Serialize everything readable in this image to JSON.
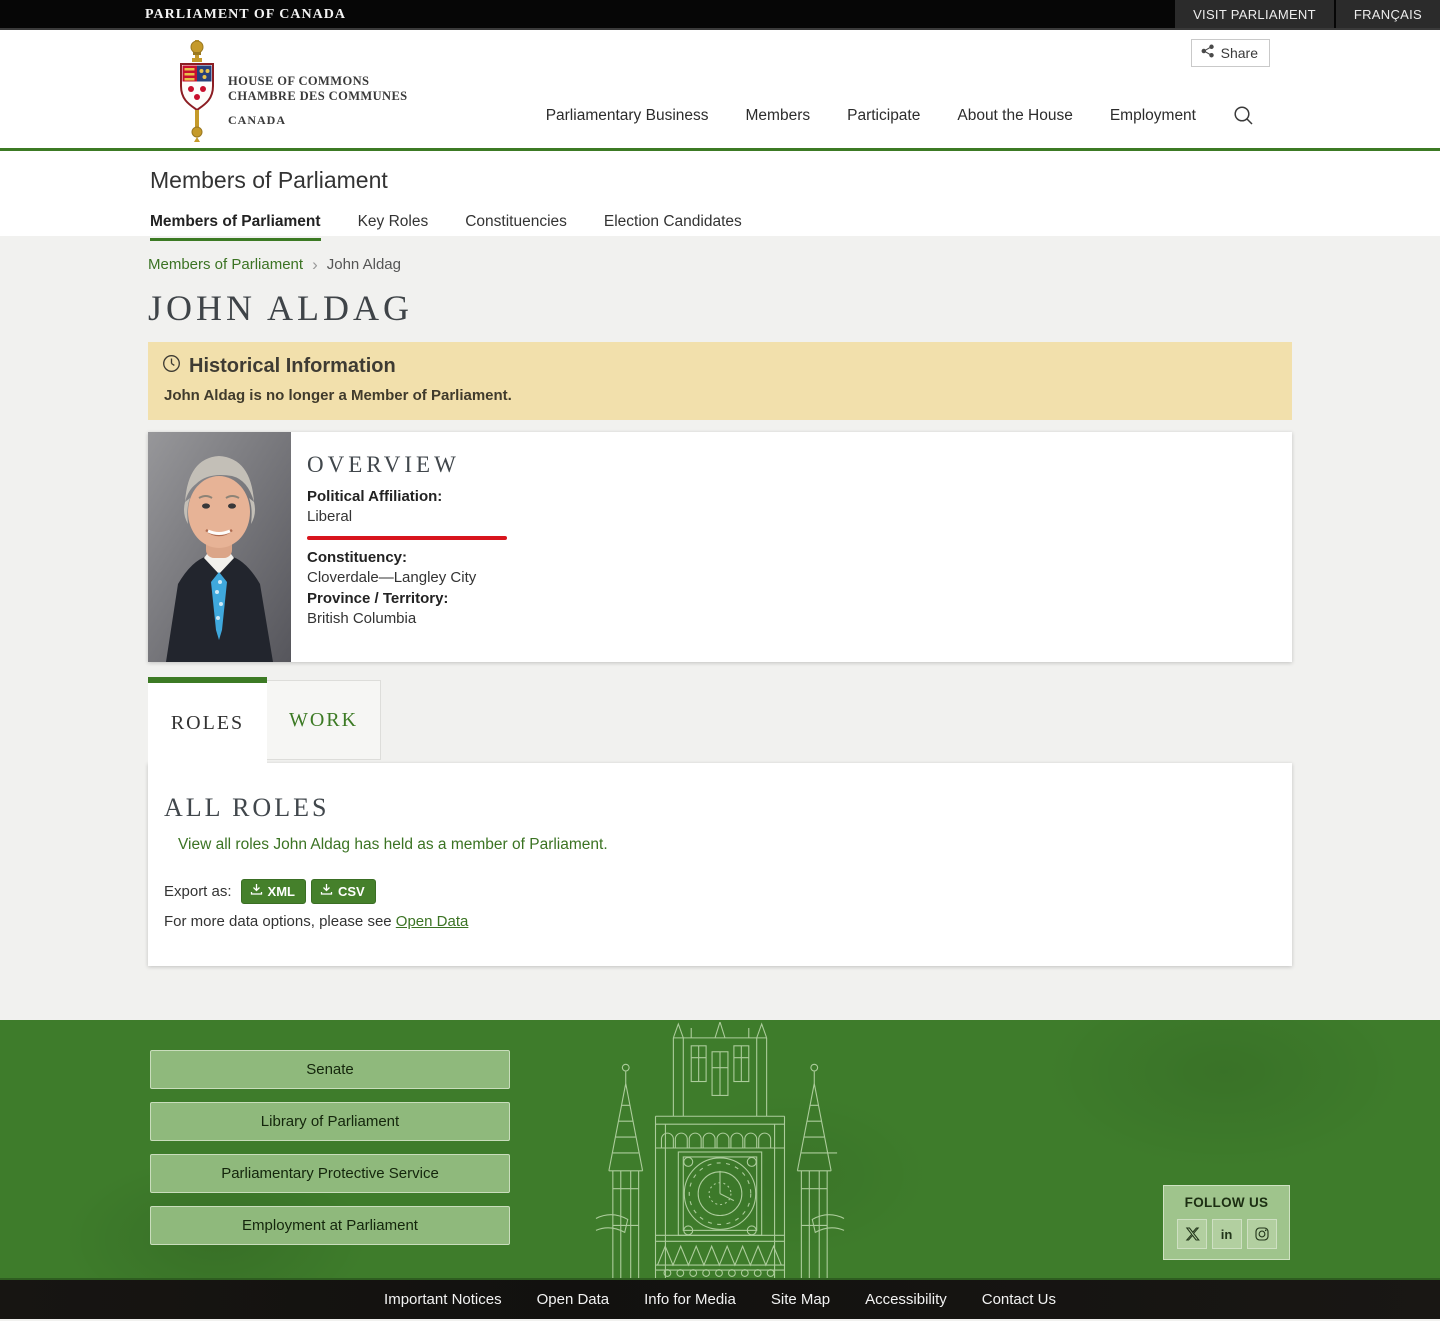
{
  "theme": {
    "accent_green": "#3c7a24",
    "footer_green": "#3e7c2b",
    "link_green": "#3b7323",
    "footer_button_green": "#8fb97c",
    "alert_background": "#f2e0ac",
    "liberal_red": "#d8151d",
    "topbar_black": "#060606",
    "topbar_tab_gray": "#2b2b2b"
  },
  "topbar": {
    "brand": "PARLIAMENT OF CANADA",
    "links": [
      {
        "label": "VISIT PARLIAMENT"
      },
      {
        "label": "FRANÇAIS"
      }
    ]
  },
  "header": {
    "logo": {
      "line1": "HOUSE OF COMMONS",
      "line2": "CHAMBRE DES COMMUNES",
      "line3": "CANADA"
    },
    "share_label": "Share",
    "nav": [
      {
        "label": "Parliamentary Business"
      },
      {
        "label": "Members"
      },
      {
        "label": "Participate"
      },
      {
        "label": "About the House"
      },
      {
        "label": "Employment"
      }
    ]
  },
  "section": {
    "title": "Members of Parliament",
    "tabs": [
      {
        "label": "Members of Parliament",
        "active": true
      },
      {
        "label": "Key Roles",
        "active": false
      },
      {
        "label": "Constituencies",
        "active": false
      },
      {
        "label": "Election Candidates",
        "active": false
      }
    ]
  },
  "breadcrumb": {
    "parent": "Members of Parliament",
    "separator": "›",
    "current": "John Aldag"
  },
  "page": {
    "title": "JOHN ALDAG"
  },
  "alert": {
    "title": "Historical Information",
    "message": "John Aldag is no longer a Member of Parliament."
  },
  "overview": {
    "heading": "OVERVIEW",
    "fields": [
      {
        "label": "Political Affiliation:",
        "value": "Liberal"
      },
      {
        "label": "Constituency:",
        "value": "Cloverdale—Langley City"
      },
      {
        "label": "Province / Territory:",
        "value": "British Columbia"
      }
    ]
  },
  "profile_tabs": [
    {
      "label": "ROLES",
      "active": true
    },
    {
      "label": "WORK",
      "active": false
    }
  ],
  "roles_panel": {
    "heading": "ALL ROLES",
    "link": "View all roles John Aldag has held as a member of Parliament.",
    "export_label": "Export as:",
    "export_buttons": [
      {
        "label": "XML"
      },
      {
        "label": "CSV"
      }
    ],
    "more_text": "For more data options, please see ",
    "more_link": "Open Data"
  },
  "footer": {
    "buttons": [
      {
        "label": "Senate"
      },
      {
        "label": "Library of Parliament"
      },
      {
        "label": "Parliamentary Protective Service"
      },
      {
        "label": "Employment at Parliament"
      }
    ],
    "follow": {
      "title": "FOLLOW US",
      "icons": [
        "x-twitter-icon",
        "linkedin-icon",
        "instagram-icon"
      ]
    }
  },
  "bottombar": {
    "links": [
      {
        "label": "Important Notices"
      },
      {
        "label": "Open Data"
      },
      {
        "label": "Info for Media"
      },
      {
        "label": "Site Map"
      },
      {
        "label": "Accessibility"
      },
      {
        "label": "Contact Us"
      }
    ]
  }
}
